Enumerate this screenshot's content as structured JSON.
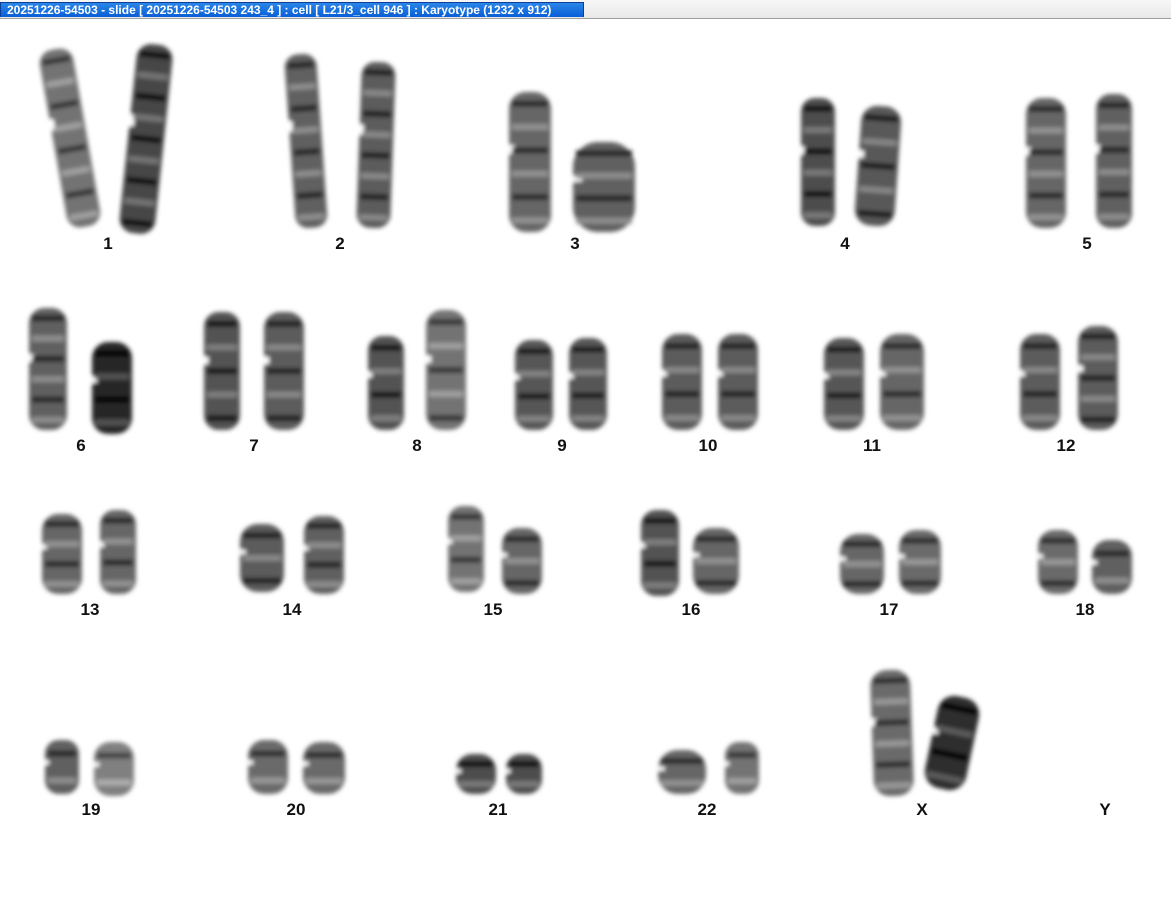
{
  "window": {
    "title": "20251226-54503 - slide [ 20251226-54503 243_4 ] : cell [ L21/3_cell 946 ] : Karyotype  (1232 x 912)"
  },
  "karyotype": {
    "chromosomes": [
      {
        "id": "chr-1",
        "label": "1"
      },
      {
        "id": "chr-2",
        "label": "2"
      },
      {
        "id": "chr-3",
        "label": "3"
      },
      {
        "id": "chr-4",
        "label": "4"
      },
      {
        "id": "chr-5",
        "label": "5"
      },
      {
        "id": "chr-6",
        "label": "6"
      },
      {
        "id": "chr-7",
        "label": "7"
      },
      {
        "id": "chr-8",
        "label": "8"
      },
      {
        "id": "chr-9",
        "label": "9"
      },
      {
        "id": "chr-10",
        "label": "10"
      },
      {
        "id": "chr-11",
        "label": "11"
      },
      {
        "id": "chr-12",
        "label": "12"
      },
      {
        "id": "chr-13",
        "label": "13"
      },
      {
        "id": "chr-14",
        "label": "14"
      },
      {
        "id": "chr-15",
        "label": "15"
      },
      {
        "id": "chr-16",
        "label": "16"
      },
      {
        "id": "chr-17",
        "label": "17"
      },
      {
        "id": "chr-18",
        "label": "18"
      },
      {
        "id": "chr-19",
        "label": "19"
      },
      {
        "id": "chr-20",
        "label": "20"
      },
      {
        "id": "chr-21",
        "label": "21"
      },
      {
        "id": "chr-22",
        "label": "22"
      },
      {
        "id": "chr-x",
        "label": "X"
      },
      {
        "id": "chr-y",
        "label": "Y"
      }
    ]
  }
}
